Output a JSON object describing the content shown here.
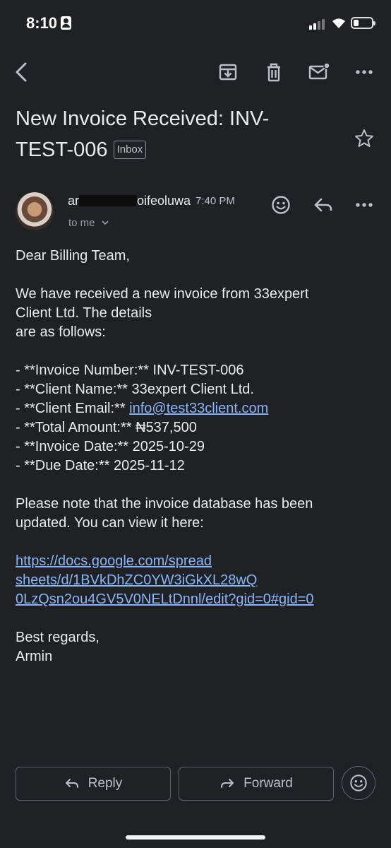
{
  "status_bar": {
    "time": "8:10",
    "icons": [
      "person-icon",
      "signal-icon",
      "wifi-icon",
      "battery-icon"
    ]
  },
  "toolbar": {
    "icons": [
      "back-arrow-icon",
      "archive-icon",
      "delete-icon",
      "mark-unread-icon",
      "more-icon"
    ]
  },
  "email": {
    "subject": "New Invoice Received: INV-TEST-006",
    "label": "Inbox",
    "sender_name_visible": "oifeoluwa",
    "sender_name_prefix": "ar",
    "time": "7:40 PM",
    "recipient": "to me",
    "body": {
      "greeting": "Dear Billing Team,",
      "intro_1": "We have received a new invoice from 33expert",
      "intro_2": "Client Ltd. The details",
      "intro_3": "are as follows:",
      "items": [
        "- **Invoice Number:** INV-TEST-006",
        "- **Client Name:** 33expert Client Ltd.",
        "- **Client Email:** ",
        "- **Total Amount:** ₦537,500",
        "- **Invoice Date:** 2025-10-29",
        "- **Due Date:** 2025-11-12"
      ],
      "client_email": "info@test33client.com",
      "note_1": "Please note that the invoice database has been",
      "note_2": "updated. You can view it here:",
      "link_1": "https://docs.google.com/spread",
      "link_2": "sheets/d/1BVkDhZC0YW3iGkXL28wQ",
      "link_3": "0LzQsn2ou4GV5V0NELtDnnl/edit?gid=0#gid=0",
      "closing": "Best regards,",
      "signature": "Armin"
    }
  },
  "actions": {
    "reply": "Reply",
    "forward": "Forward"
  },
  "colors": {
    "background": "#202124",
    "text": "#e8eaed",
    "link": "#8ab4f8",
    "muted": "#9aa0a6"
  }
}
